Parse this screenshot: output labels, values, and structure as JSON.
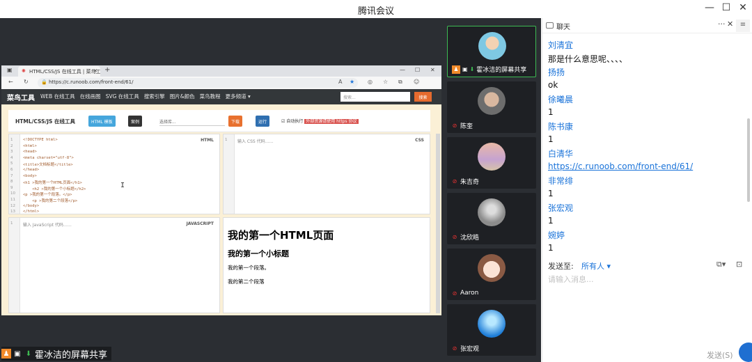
{
  "window": {
    "title": "腾讯会议",
    "controls": [
      "—",
      "☐",
      "✕"
    ]
  },
  "share": {
    "label": "霍冰洁的屏幕共享",
    "browser": {
      "tab_title": "HTML/CSS/JS 在线工具 | 菜鸟工具",
      "url": "https://c.runoob.com/front-end/61/",
      "nav_logo": "菜鸟工具",
      "nav_items": [
        "WEB 在线工具",
        "在线画图",
        "SVG 在线工具",
        "搜索引擎",
        "图片&颜色",
        "菜鸟教程",
        "更多频道 ▾"
      ],
      "search_placeholder": "搜索...",
      "search_button": "搜索"
    },
    "tool": {
      "title": "HTML/CSS/JS 在线工具",
      "buttons": {
        "html_template": "HTML 模板",
        "examples": "案例",
        "select_library": "选择库...",
        "download": "下载",
        "run": "运行",
        "auto_run": "自动执行",
        "notice": "外部资源请使用 https 协议"
      }
    },
    "editors": {
      "html_label": "HTML",
      "css_label": "CSS",
      "js_label": "JAVASCRIPT",
      "css_placeholder": "输入 CSS 代码……",
      "js_placeholder": "输入 JavaScript 代码……",
      "html_lines": [
        "<!DOCTYPE html>",
        "<html>",
        "<head>",
        "<meta charset=\"utf-8\">",
        "<title>文档标题</title>",
        "</head>",
        "<body>",
        "<h1 >我的第一个HTML页面</h1>",
        "    <h2 >我的第一个小标题</h2>",
        "<p >我的第一个段落。</p>",
        "    <p >我的第二个段落</p>",
        "</body>",
        "</html>"
      ]
    },
    "preview": {
      "h1": "我的第一个HTML页面",
      "h2": "我的第一个小标题",
      "p1": "我的第一个段落。",
      "p2": "我的第二个段落"
    }
  },
  "participants": [
    {
      "name": "霍冰洁的屏幕共享",
      "active": true
    },
    {
      "name": "陈奎"
    },
    {
      "name": "朱吉奇"
    },
    {
      "name": "沈欣皓"
    },
    {
      "name": "Aaron"
    },
    {
      "name": "张宏观"
    }
  ],
  "chat": {
    "title": "聊天",
    "messages": [
      {
        "type": "name",
        "text": "刘清宜"
      },
      {
        "type": "text",
        "text": "那是什么意思呢、、、、"
      },
      {
        "type": "name",
        "text": "扬扬"
      },
      {
        "type": "text",
        "text": "ok"
      },
      {
        "type": "name",
        "text": "徐曦晨"
      },
      {
        "type": "text",
        "text": "1"
      },
      {
        "type": "name",
        "text": "陈书康"
      },
      {
        "type": "text",
        "text": "1"
      },
      {
        "type": "name",
        "text": "白清华"
      },
      {
        "type": "link",
        "text": "https://c.runoob.com/front-end/61/"
      },
      {
        "type": "name",
        "text": "非常绯"
      },
      {
        "type": "text",
        "text": "1"
      },
      {
        "type": "name",
        "text": "张宏观"
      },
      {
        "type": "text",
        "text": "1"
      },
      {
        "type": "name",
        "text": "婉婷"
      },
      {
        "type": "text",
        "text": "1"
      }
    ],
    "send_to_label": "发送至:",
    "send_to_value": "所有人 ▾",
    "input_placeholder": "请输入消息...",
    "send_button": "发送(S)"
  },
  "colors": {
    "accent": "#1a73d9",
    "stage_bg": "#2b2e33",
    "active_border": "#3dbb52"
  }
}
